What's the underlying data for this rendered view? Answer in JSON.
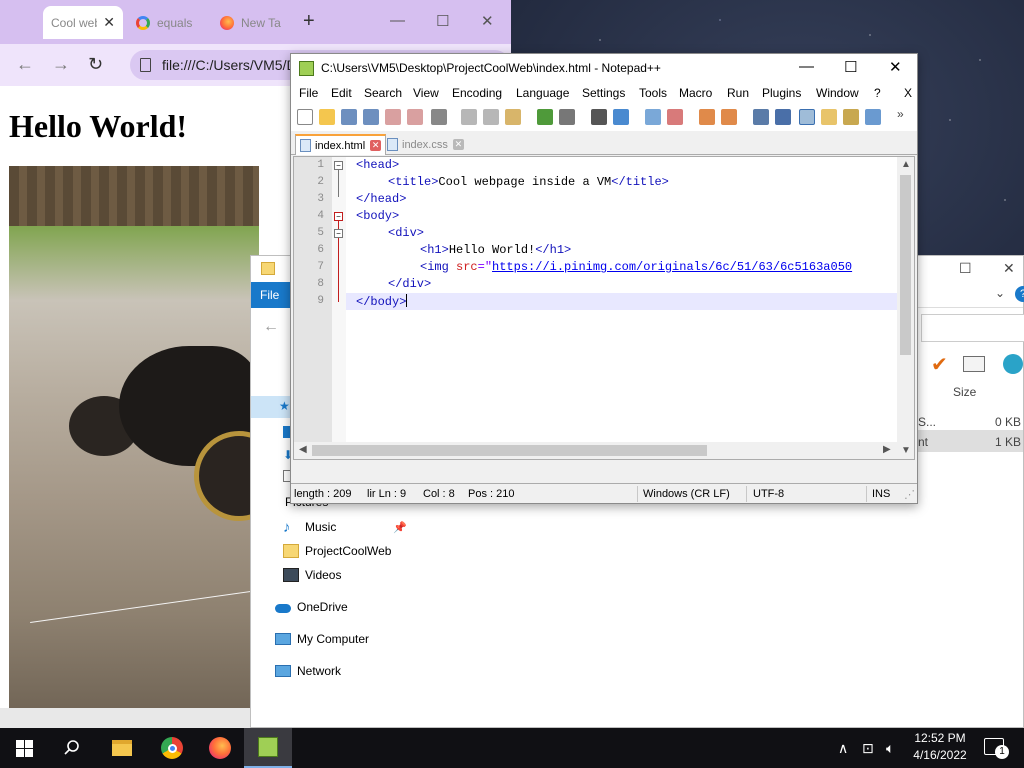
{
  "chrome": {
    "tabs": [
      {
        "label": "Cool web",
        "icon": "page-icon"
      },
      {
        "label": "equals",
        "icon": "google-icon"
      },
      {
        "label": "New Ta",
        "icon": "firefox-icon"
      }
    ],
    "new_tab": "+",
    "address": "file:///C:/Users/VM5/D",
    "page": {
      "heading": "Hello World!"
    }
  },
  "explorer": {
    "ribbon_tab": "File",
    "nav_items": [
      {
        "label": "Pictures",
        "icon": "pictures-icon"
      },
      {
        "label": "Music",
        "icon": "music-icon"
      },
      {
        "label": "ProjectCoolWeb",
        "icon": "folder-icon"
      },
      {
        "label": "Videos",
        "icon": "videos-icon"
      },
      {
        "label": "OneDrive",
        "icon": "onedrive-icon"
      },
      {
        "label": "My Computer",
        "icon": "computer-icon"
      },
      {
        "label": "Network",
        "icon": "network-icon"
      }
    ],
    "column_size": "Size",
    "rows": [
      {
        "name": "S...",
        "size": "0 KB"
      },
      {
        "name": "nt",
        "size": "1 KB"
      }
    ]
  },
  "npp": {
    "title": "C:\\Users\\VM5\\Desktop\\ProjectCoolWeb\\index.html - Notepad++",
    "menu": [
      "File",
      "Edit",
      "Search",
      "View",
      "Encoding",
      "Language",
      "Settings",
      "Tools",
      "Macro",
      "Run",
      "Plugins",
      "Window",
      "?"
    ],
    "menu_close": "X",
    "tabs": [
      {
        "label": "index.html",
        "active": true
      },
      {
        "label": "index.css",
        "active": false
      }
    ],
    "line_numbers": [
      "1",
      "2",
      "3",
      "4",
      "5",
      "6",
      "7",
      "8",
      "9"
    ],
    "code": {
      "l1_tag": "<head>",
      "l2_open": "<title>",
      "l2_text": "Cool webpage inside a VM",
      "l2_close": "</title>",
      "l3_tag": "</head>",
      "l4_tag": "<body>",
      "l5_tag": "<div>",
      "l6_open": "<h1>",
      "l6_text": "Hello World!",
      "l6_close": "</h1>",
      "l7_open": "<img",
      "l7_attr": " src",
      "l7_eq": "=\"",
      "l7_url": "https://i.pinimg.com/originals/6c/51/63/6c5163a050",
      "l8_tag": "</div>",
      "l9_tag": "</body>"
    },
    "status": {
      "length": "length : 209",
      "lines": "lir Ln : 9",
      "col": "Col : 8",
      "pos": "Pos : 210",
      "eol": "Windows (CR LF)",
      "encoding": "UTF-8",
      "mode": "INS"
    }
  },
  "taskbar": {
    "time": "12:52 PM",
    "date": "4/16/2022",
    "notification_count": "1",
    "apps": [
      "file-explorer-icon",
      "chrome-icon",
      "firefox-icon",
      "notepadpp-icon"
    ]
  }
}
